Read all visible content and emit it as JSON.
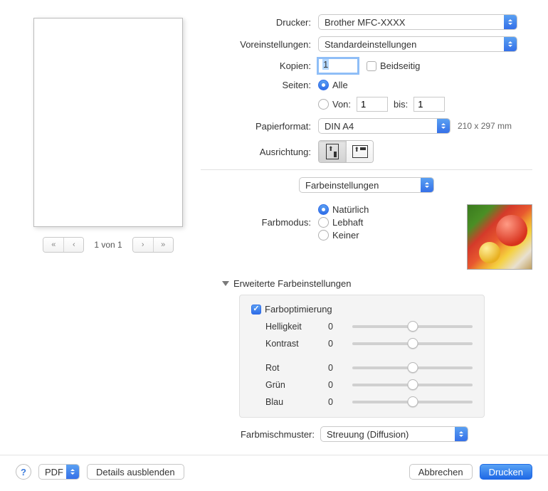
{
  "labels": {
    "printer": "Drucker:",
    "presets": "Voreinstellungen:",
    "copies": "Kopien:",
    "doublesided": "Beidseitig",
    "pages": "Seiten:",
    "pages_all": "Alle",
    "pages_from": "Von:",
    "pages_to": "bis:",
    "papersize": "Papierformat:",
    "orientation": "Ausrichtung:",
    "section_select": "Farbeinstellungen",
    "colormode": "Farbmodus:",
    "opt_natural": "Natürlich",
    "opt_vivid": "Lebhaft",
    "opt_none": "Keiner",
    "advanced": "Erweiterte Farbeinstellungen",
    "color_opt_check": "Farboptimierung",
    "brightness": "Helligkeit",
    "contrast": "Kontrast",
    "red": "Rot",
    "green": "Grün",
    "blue": "Blau",
    "halftone": "Farbmischmuster:",
    "halftone_val": "Streuung (Diffusion)",
    "pdf": "PDF",
    "details": "Details ausblenden",
    "cancel": "Abbrechen",
    "print": "Drucken"
  },
  "values": {
    "printer": "Brother MFC-XXXX",
    "presets": "Standardeinstellungen",
    "copies": "1",
    "pages_from": "1",
    "pages_to": "1",
    "papersize": "DIN A4",
    "paper_dim": "210 x 297 mm",
    "brightness": "0",
    "contrast": "0",
    "red": "0",
    "green": "0",
    "blue": "0"
  },
  "preview": {
    "page_indicator": "1 von 1"
  }
}
